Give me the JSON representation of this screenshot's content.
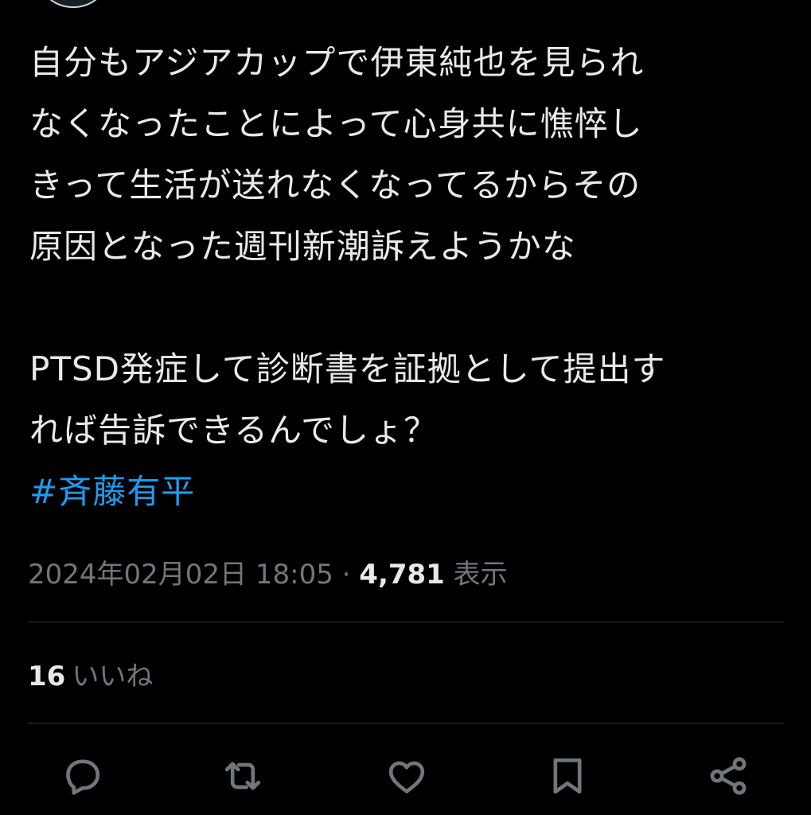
{
  "tweet": {
    "lines": [
      "自分もアジアカップで伊東純也を見られ",
      "なくなったことによって心身共に憔悴し",
      "きって生活が送れなくなってるからその",
      "原因となった週刊新潮訴えようかな"
    ],
    "lines2": [
      "PTSD発症して診断書を証拠として提出す",
      "れば告訴できるんでしょ？"
    ],
    "hashtag": "#斉藤有平"
  },
  "meta": {
    "timestamp": "2024年02月02日 18:05",
    "separator": " · ",
    "views_count": "4,781",
    "views_label": "表示"
  },
  "likes": {
    "count": "16",
    "label": "いいね"
  },
  "actions": {
    "reply_icon": "reply-icon",
    "retweet_icon": "retweet-icon",
    "like_icon": "heart-icon",
    "bookmark_icon": "bookmark-icon",
    "share_icon": "share-icon"
  },
  "colors": {
    "background": "#000000",
    "text": "#e7e9ea",
    "secondary": "#71767b",
    "link": "#1d9bf0",
    "divider": "#2f3336"
  }
}
